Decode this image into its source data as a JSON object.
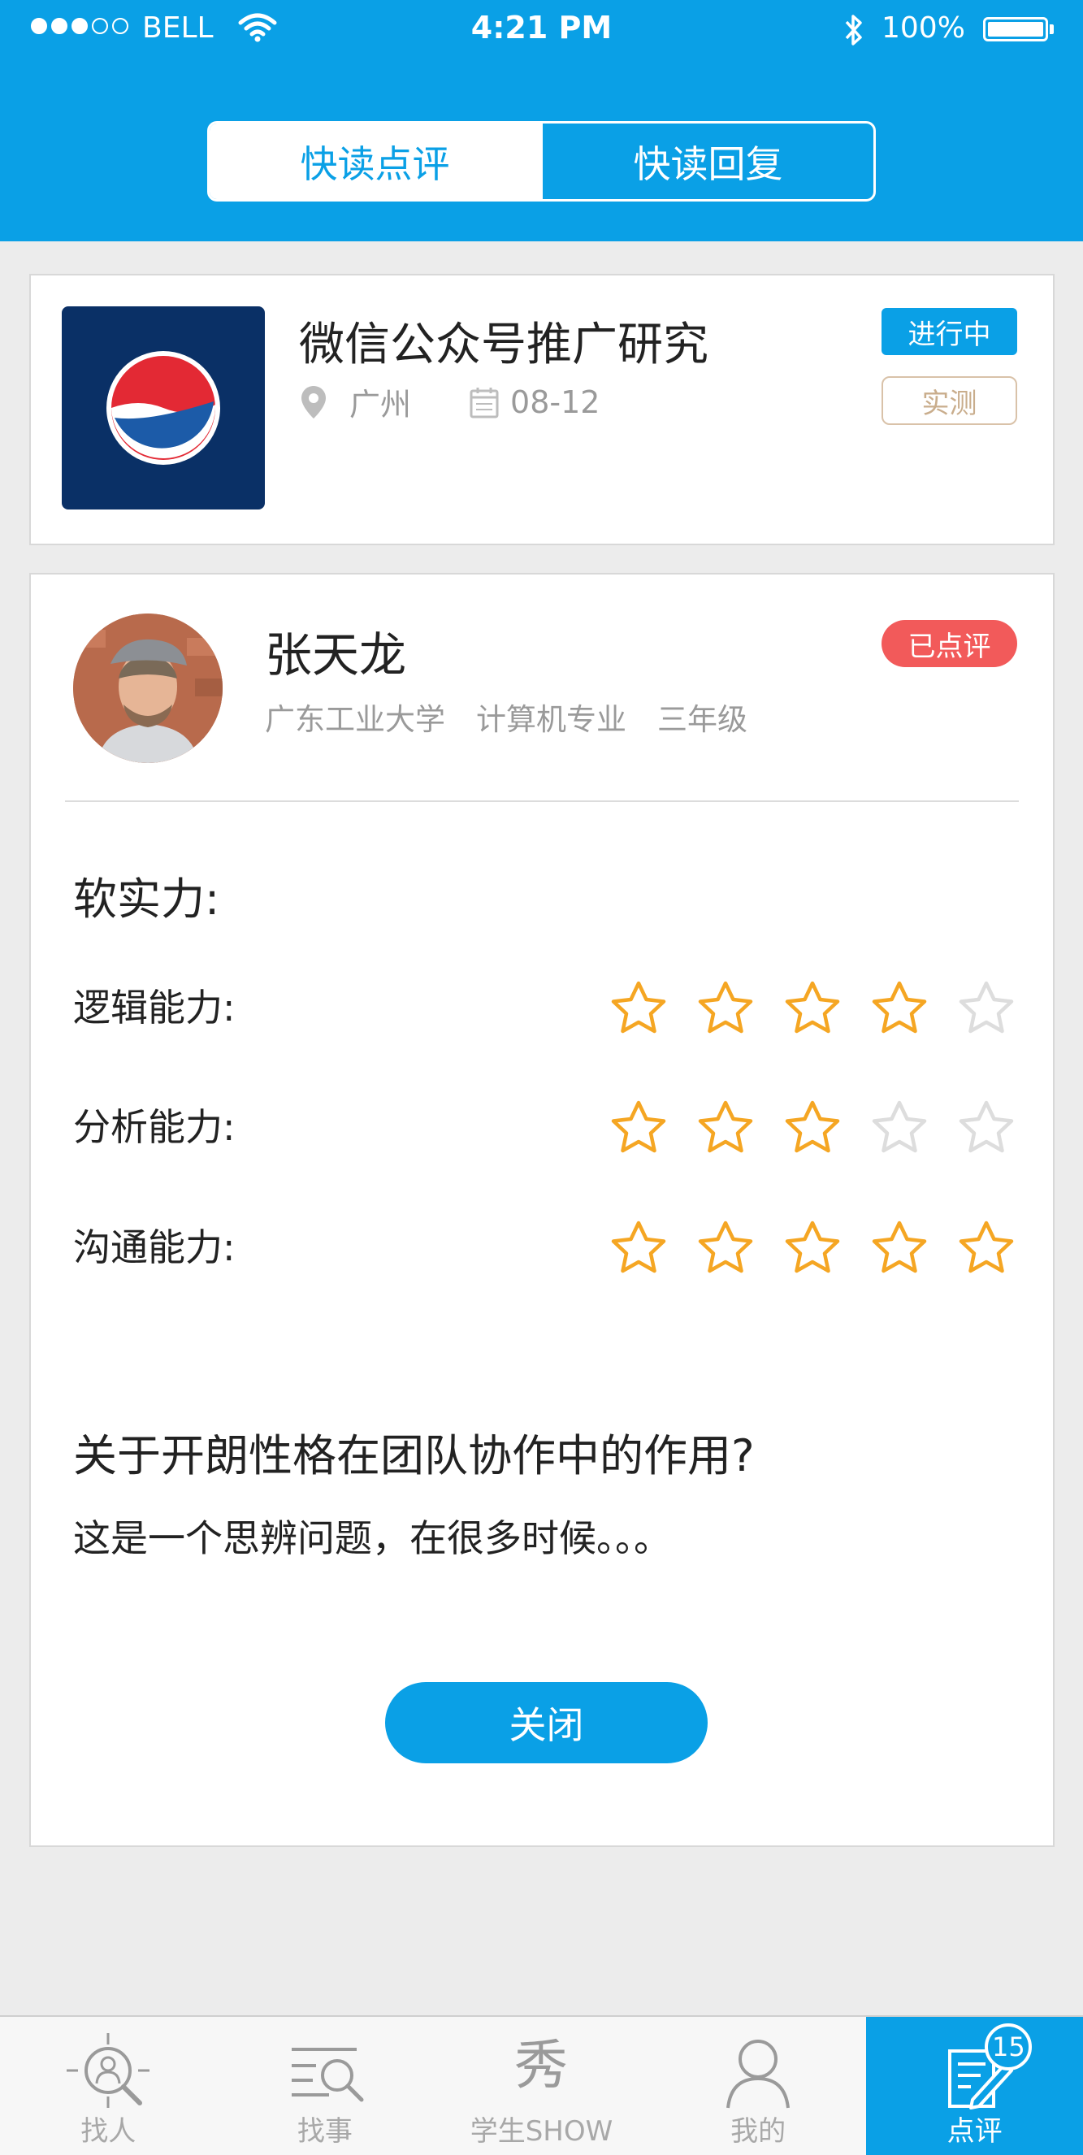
{
  "status_bar": {
    "carrier": "BELL",
    "time": "4:21 PM",
    "battery": "100%"
  },
  "segmented": {
    "tabs": [
      {
        "label": "快读点评",
        "active": true
      },
      {
        "label": "快读回复",
        "active": false
      }
    ]
  },
  "project": {
    "title": "微信公众号推广研究",
    "city": "广州",
    "date": "08-12",
    "status": "进行中",
    "type": "实测"
  },
  "review": {
    "name": "张天龙",
    "university": "广东工业大学",
    "major": "计算机专业",
    "grade": "三年级",
    "status": "已点评",
    "section_title": "软实力:",
    "ratings": [
      {
        "label": "逻辑能力:",
        "stars": 4,
        "max": 5
      },
      {
        "label": "分析能力:",
        "stars": 3,
        "max": 5
      },
      {
        "label": "沟通能力:",
        "stars": 5,
        "max": 5
      }
    ],
    "question": "关于开朗性格在团队协作中的作用?",
    "answer": "这是一个思辨问题，在很多时候。。。",
    "close_label": "关闭"
  },
  "tabbar": {
    "items": [
      {
        "label": "找人",
        "icon": "find-person-icon",
        "active": false
      },
      {
        "label": "找事",
        "icon": "find-job-icon",
        "active": false
      },
      {
        "label": "学生SHOW",
        "icon": "show-icon",
        "active": false
      },
      {
        "label": "我的",
        "icon": "profile-icon",
        "active": false
      },
      {
        "label": "点评",
        "icon": "review-icon",
        "active": true,
        "badge": "15"
      }
    ]
  },
  "colors": {
    "primary": "#0aa0e6",
    "star_on": "#f5a623",
    "star_off": "#dddddd",
    "reviewed": "#f25a5a",
    "type_border": "#d9c2a9"
  }
}
